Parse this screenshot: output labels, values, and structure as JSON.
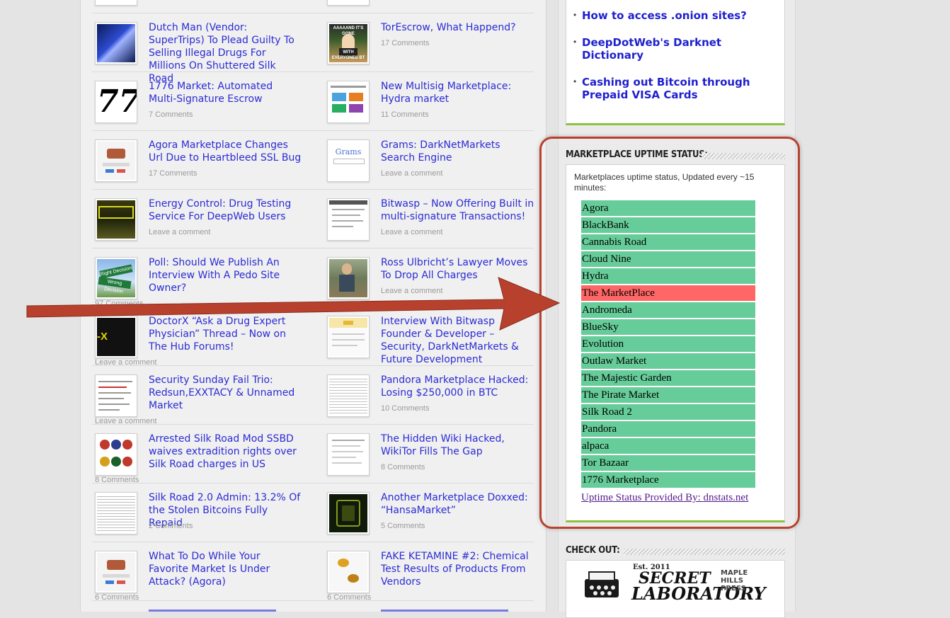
{
  "left_posts": [
    {
      "title": "Dutch Man (Vendor: SuperTrips) To Plead Guilty To Selling Illegal Drugs For Millions On Shuttered Silk Road",
      "comments": ""
    },
    {
      "title": "1776 Market: Automated Multi-Signature Escrow",
      "comments": "7 Comments"
    },
    {
      "title": "Agora Marketplace Changes Url Due to Heartbleed SSL Bug",
      "comments": "17 Comments"
    },
    {
      "title": "Energy Control: Drug Testing Service For DeepWeb Users",
      "comments": "Leave a comment"
    },
    {
      "title": "Poll: Should We Publish An Interview With A Pedo Site Owner?",
      "comments": "97 Comments"
    },
    {
      "title": "DoctorX “Ask a Drug Expert Physician” Thread – Now on The Hub Forums!",
      "comments": "Leave a comment"
    },
    {
      "title": "Security Sunday Fail Trio: Redsun,EXXTACY & Unnamed Market",
      "comments": "Leave a comment"
    },
    {
      "title": "Arrested Silk Road Mod SSBD waives extradition rights over Silk Road charges in US",
      "comments": "8 Comments"
    },
    {
      "title": "Silk Road 2.0 Admin: 13.2% Of the Stolen Bitcoins Fully Repaid",
      "comments": "2 Comments"
    },
    {
      "title": "What To Do While Your Favorite Market Is Under Attack? (Agora)",
      "comments": "6 Comments"
    }
  ],
  "right_posts": [
    {
      "title": "TorEscrow, What Happend?",
      "comments": "17 Comments"
    },
    {
      "title": "New Multisig Marketplace: Hydra market",
      "comments": "11 Comments"
    },
    {
      "title": "Grams: DarkNetMarkets Search Engine",
      "comments": "Leave a comment"
    },
    {
      "title": "Bitwasp – Now Offering Built in multi-signature Transactions!",
      "comments": "Leave a comment"
    },
    {
      "title": "Ross Ulbricht’s Lawyer Moves To Drop All Charges",
      "comments": "Leave a comment"
    },
    {
      "title": "Interview With Bitwasp Founder & Developer – Security, DarkNetMarkets & Future Development",
      "comments": ""
    },
    {
      "title": "Pandora Marketplace Hacked: Losing $250,000 in BTC",
      "comments": "10 Comments"
    },
    {
      "title": "The Hidden Wiki Hacked, WikiTor Fills The Gap",
      "comments": "8 Comments"
    },
    {
      "title": "Another Marketplace Doxxed: “HansaMarket”",
      "comments": "5 Comments"
    },
    {
      "title": "FAKE KETAMINE #2: Chemical Test Results of Products From Vendors",
      "comments": "6 Comments"
    }
  ],
  "thumb_texts": {
    "tor_escrow": "AAAAAND IT'S GONE",
    "tor_escrow_bottom": "WITH EVERYONES BT",
    "seventy_seven": "77",
    "grams": "Grams",
    "doctorx": "-X",
    "right_decision": "Right Decision",
    "wrong_decision": "Wrong Decision"
  },
  "sidebar_links": [
    "How to access .onion sites?",
    "DeepDotWeb's Darknet Dictionary",
    "Cashing out Bitcoin through Prepaid VISA Cards"
  ],
  "uptime": {
    "title": "Marketplace Uptime Status:",
    "intro": "Marketplaces uptime status, Updated every ~15 minutes:",
    "markets": [
      {
        "name": "Agora",
        "status": "up"
      },
      {
        "name": "BlackBank",
        "status": "up"
      },
      {
        "name": "Cannabis Road",
        "status": "up"
      },
      {
        "name": "Cloud Nine",
        "status": "up"
      },
      {
        "name": "Hydra",
        "status": "up"
      },
      {
        "name": "The MarketPlace",
        "status": "down"
      },
      {
        "name": "Andromeda",
        "status": "up"
      },
      {
        "name": "BlueSky",
        "status": "up"
      },
      {
        "name": "Evolution",
        "status": "up"
      },
      {
        "name": "Outlaw Market",
        "status": "up"
      },
      {
        "name": "The Majestic Garden",
        "status": "up"
      },
      {
        "name": "The Pirate Market",
        "status": "up"
      },
      {
        "name": "Silk Road 2",
        "status": "up"
      },
      {
        "name": "Pandora",
        "status": "up"
      },
      {
        "name": "alpaca",
        "status": "up"
      },
      {
        "name": "Tor Bazaar",
        "status": "up"
      },
      {
        "name": "1776 Marketplace",
        "status": "up"
      }
    ],
    "provided_by": "Uptime Status Provided By: dnstats.net"
  },
  "checkout": {
    "title": "Check Out:",
    "banner_est": "Est. 2011",
    "banner_line1": "SECRET",
    "banner_line2": "LABORATORY",
    "banner_press": "MAPLE HILLS PRESS"
  },
  "colors": {
    "link": "#2b2bd6",
    "up": "#66cc99",
    "down": "#ff6666",
    "ring": "#b8422e",
    "accent_green": "#8ac43f"
  }
}
